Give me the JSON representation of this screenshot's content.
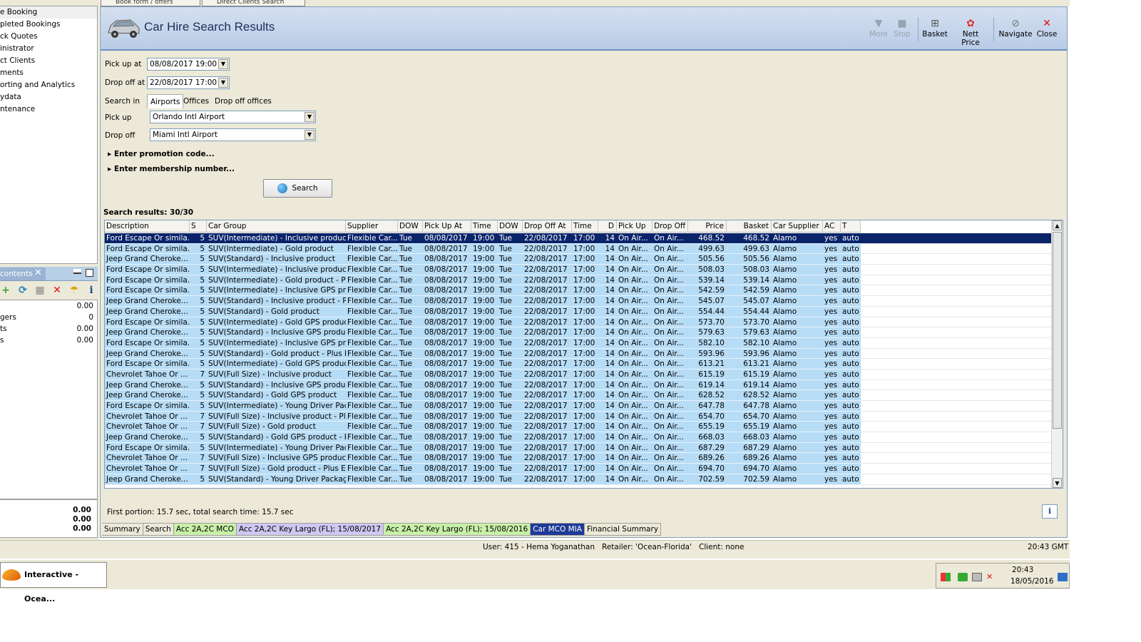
{
  "window": {
    "title": "Car Hire Search Results"
  },
  "top_tabs": [
    "Book form / offers",
    "Direct Clients Search"
  ],
  "sidebar": {
    "items": [
      {
        "label": "e Booking",
        "selected": true
      },
      {
        "label": "pleted Bookings"
      },
      {
        "label": "ck Quotes"
      },
      {
        "label": "inistrator"
      },
      {
        "label": "ct Clients"
      },
      {
        "label": "ments"
      },
      {
        "label": "orting and Analytics"
      },
      {
        "label": "ydata"
      },
      {
        "label": "ntenance"
      }
    ]
  },
  "contents": {
    "tab_label": "contents",
    "rows": [
      {
        "label": "",
        "value": "0.00"
      },
      {
        "label": "gers",
        "value": "0"
      },
      {
        "label": "ts",
        "value": "0.00"
      },
      {
        "label": "s",
        "value": "0.00"
      }
    ],
    "totals": [
      "0.00",
      "0.00",
      "0.00"
    ]
  },
  "toolbar": {
    "more": "More",
    "stop": "Stop",
    "basket": "Basket",
    "nett_price": "Nett Price",
    "navigate": "Navigate",
    "close": "Close"
  },
  "form": {
    "pickup_at_label": "Pick up at",
    "pickup_at_value": "08/08/2017 19:00",
    "dropoff_at_label": "Drop off at",
    "dropoff_at_value": "22/08/2017 17:00",
    "search_in_label": "Search in",
    "search_in_tabs": [
      "Airports",
      "Offices",
      "Drop off offices"
    ],
    "pickup_label": "Pick up",
    "pickup_value": "Orlando Intl Airport",
    "dropoff_label": "Drop off",
    "dropoff_value": "Miami Intl Airport",
    "promo_label": "Enter promotion code...",
    "membership_label": "Enter membership number...",
    "search_button": "Search"
  },
  "results": {
    "label": "Search results: 30/30",
    "columns": [
      "Description",
      "S",
      "Car Group",
      "Supplier",
      "DOW",
      "Pick Up At",
      "Time",
      "DOW",
      "Drop Off At",
      "Time",
      "D",
      "Pick Up",
      "Drop Off",
      "Price",
      "Basket",
      "Car Supplier",
      "AC",
      "T"
    ],
    "rows": [
      [
        "Ford Escape Or simila...",
        "5",
        "SUV(Intermediate) - Inclusive product",
        "Flexible Car...",
        "Tue",
        "08/08/2017",
        "19:00",
        "Tue",
        "22/08/2017",
        "17:00",
        "14",
        "On Air...",
        "On Air...",
        "468.52",
        "468.52",
        "Alamo",
        "yes",
        "auto"
      ],
      [
        "Ford Escape Or simila...",
        "5",
        "SUV(Intermediate) - Gold product",
        "Flexible Car...",
        "Tue",
        "08/08/2017",
        "19:00",
        "Tue",
        "22/08/2017",
        "17:00",
        "14",
        "On Air...",
        "On Air...",
        "499.63",
        "499.63",
        "Alamo",
        "yes",
        "auto"
      ],
      [
        "Jeep Grand Cheroke...",
        "5",
        "SUV(Standard) - Inclusive product",
        "Flexible Car...",
        "Tue",
        "08/08/2017",
        "19:00",
        "Tue",
        "22/08/2017",
        "17:00",
        "14",
        "On Air...",
        "On Air...",
        "505.56",
        "505.56",
        "Alamo",
        "yes",
        "auto"
      ],
      [
        "Ford Escape Or simila...",
        "5",
        "SUV(Intermediate) - Inclusive product...",
        "Flexible Car...",
        "Tue",
        "08/08/2017",
        "19:00",
        "Tue",
        "22/08/2017",
        "17:00",
        "14",
        "On Air...",
        "On Air...",
        "508.03",
        "508.03",
        "Alamo",
        "yes",
        "auto"
      ],
      [
        "Ford Escape Or simila...",
        "5",
        "SUV(Intermediate) - Gold product - Pl...",
        "Flexible Car...",
        "Tue",
        "08/08/2017",
        "19:00",
        "Tue",
        "22/08/2017",
        "17:00",
        "14",
        "On Air...",
        "On Air...",
        "539.14",
        "539.14",
        "Alamo",
        "yes",
        "auto"
      ],
      [
        "Ford Escape Or simila...",
        "5",
        "SUV(Intermediate) - Inclusive GPS pro...",
        "Flexible Car...",
        "Tue",
        "08/08/2017",
        "19:00",
        "Tue",
        "22/08/2017",
        "17:00",
        "14",
        "On Air...",
        "On Air...",
        "542.59",
        "542.59",
        "Alamo",
        "yes",
        "auto"
      ],
      [
        "Jeep Grand Cheroke...",
        "5",
        "SUV(Standard) - Inclusive product - Pl...",
        "Flexible Car...",
        "Tue",
        "08/08/2017",
        "19:00",
        "Tue",
        "22/08/2017",
        "17:00",
        "14",
        "On Air...",
        "On Air...",
        "545.07",
        "545.07",
        "Alamo",
        "yes",
        "auto"
      ],
      [
        "Jeep Grand Cheroke...",
        "5",
        "SUV(Standard) - Gold product",
        "Flexible Car...",
        "Tue",
        "08/08/2017",
        "19:00",
        "Tue",
        "22/08/2017",
        "17:00",
        "14",
        "On Air...",
        "On Air...",
        "554.44",
        "554.44",
        "Alamo",
        "yes",
        "auto"
      ],
      [
        "Ford Escape Or simila...",
        "5",
        "SUV(Intermediate) - Gold GPS product",
        "Flexible Car...",
        "Tue",
        "08/08/2017",
        "19:00",
        "Tue",
        "22/08/2017",
        "17:00",
        "14",
        "On Air...",
        "On Air...",
        "573.70",
        "573.70",
        "Alamo",
        "yes",
        "auto"
      ],
      [
        "Jeep Grand Cheroke...",
        "5",
        "SUV(Standard) - Inclusive GPS product",
        "Flexible Car...",
        "Tue",
        "08/08/2017",
        "19:00",
        "Tue",
        "22/08/2017",
        "17:00",
        "14",
        "On Air...",
        "On Air...",
        "579.63",
        "579.63",
        "Alamo",
        "yes",
        "auto"
      ],
      [
        "Ford Escape Or simila...",
        "5",
        "SUV(Intermediate) - Inclusive GPS pro...",
        "Flexible Car...",
        "Tue",
        "08/08/2017",
        "19:00",
        "Tue",
        "22/08/2017",
        "17:00",
        "14",
        "On Air...",
        "On Air...",
        "582.10",
        "582.10",
        "Alamo",
        "yes",
        "auto"
      ],
      [
        "Jeep Grand Cheroke...",
        "5",
        "SUV(Standard) - Gold product - Plus E...",
        "Flexible Car...",
        "Tue",
        "08/08/2017",
        "19:00",
        "Tue",
        "22/08/2017",
        "17:00",
        "14",
        "On Air...",
        "On Air...",
        "593.96",
        "593.96",
        "Alamo",
        "yes",
        "auto"
      ],
      [
        "Ford Escape Or simila...",
        "5",
        "SUV(Intermediate) - Gold GPS product...",
        "Flexible Car...",
        "Tue",
        "08/08/2017",
        "19:00",
        "Tue",
        "22/08/2017",
        "17:00",
        "14",
        "On Air...",
        "On Air...",
        "613.21",
        "613.21",
        "Alamo",
        "yes",
        "auto"
      ],
      [
        "Chevrolet Tahoe Or ...",
        "7",
        "SUV(Full Size) - Inclusive product",
        "Flexible Car...",
        "Tue",
        "08/08/2017",
        "19:00",
        "Tue",
        "22/08/2017",
        "17:00",
        "14",
        "On Air...",
        "On Air...",
        "615.19",
        "615.19",
        "Alamo",
        "yes",
        "auto"
      ],
      [
        "Jeep Grand Cheroke...",
        "5",
        "SUV(Standard) - Inclusive GPS produc...",
        "Flexible Car...",
        "Tue",
        "08/08/2017",
        "19:00",
        "Tue",
        "22/08/2017",
        "17:00",
        "14",
        "On Air...",
        "On Air...",
        "619.14",
        "619.14",
        "Alamo",
        "yes",
        "auto"
      ],
      [
        "Jeep Grand Cheroke...",
        "5",
        "SUV(Standard) - Gold GPS product",
        "Flexible Car...",
        "Tue",
        "08/08/2017",
        "19:00",
        "Tue",
        "22/08/2017",
        "17:00",
        "14",
        "On Air...",
        "On Air...",
        "628.52",
        "628.52",
        "Alamo",
        "yes",
        "auto"
      ],
      [
        "Ford Escape Or simila...",
        "5",
        "SUV(Intermediate) - Young Driver Pac...",
        "Flexible Car...",
        "Tue",
        "08/08/2017",
        "19:00",
        "Tue",
        "22/08/2017",
        "17:00",
        "14",
        "On Air...",
        "On Air...",
        "647.78",
        "647.78",
        "Alamo",
        "yes",
        "auto"
      ],
      [
        "Chevrolet Tahoe Or ...",
        "7",
        "SUV(Full Size) - Inclusive product - Plu...",
        "Flexible Car...",
        "Tue",
        "08/08/2017",
        "19:00",
        "Tue",
        "22/08/2017",
        "17:00",
        "14",
        "On Air...",
        "On Air...",
        "654.70",
        "654.70",
        "Alamo",
        "yes",
        "auto"
      ],
      [
        "Chevrolet Tahoe Or ...",
        "7",
        "SUV(Full Size) - Gold product",
        "Flexible Car...",
        "Tue",
        "08/08/2017",
        "19:00",
        "Tue",
        "22/08/2017",
        "17:00",
        "14",
        "On Air...",
        "On Air...",
        "655.19",
        "655.19",
        "Alamo",
        "yes",
        "auto"
      ],
      [
        "Jeep Grand Cheroke...",
        "5",
        "SUV(Standard) - Gold GPS product - Pl...",
        "Flexible Car...",
        "Tue",
        "08/08/2017",
        "19:00",
        "Tue",
        "22/08/2017",
        "17:00",
        "14",
        "On Air...",
        "On Air...",
        "668.03",
        "668.03",
        "Alamo",
        "yes",
        "auto"
      ],
      [
        "Ford Escape Or simila...",
        "5",
        "SUV(Intermediate) - Young Driver Pac...",
        "Flexible Car...",
        "Tue",
        "08/08/2017",
        "19:00",
        "Tue",
        "22/08/2017",
        "17:00",
        "14",
        "On Air...",
        "On Air...",
        "687.29",
        "687.29",
        "Alamo",
        "yes",
        "auto"
      ],
      [
        "Chevrolet Tahoe Or ...",
        "7",
        "SUV(Full Size) - Inclusive GPS product",
        "Flexible Car...",
        "Tue",
        "08/08/2017",
        "19:00",
        "Tue",
        "22/08/2017",
        "17:00",
        "14",
        "On Air...",
        "On Air...",
        "689.26",
        "689.26",
        "Alamo",
        "yes",
        "auto"
      ],
      [
        "Chevrolet Tahoe Or ...",
        "7",
        "SUV(Full Size) - Gold product - Plus Ex...",
        "Flexible Car...",
        "Tue",
        "08/08/2017",
        "19:00",
        "Tue",
        "22/08/2017",
        "17:00",
        "14",
        "On Air...",
        "On Air...",
        "694.70",
        "694.70",
        "Alamo",
        "yes",
        "auto"
      ],
      [
        "Jeep Grand Cheroke...",
        "5",
        "SUV(Standard) - Young Driver Packag...",
        "Flexible Car...",
        "Tue",
        "08/08/2017",
        "19:00",
        "Tue",
        "22/08/2017",
        "17:00",
        "14",
        "On Air...",
        "On Air...",
        "702.59",
        "702.59",
        "Alamo",
        "yes",
        "auto"
      ]
    ]
  },
  "timing_text": "First portion: 15.7 sec, total search time: 15.7 sec",
  "bottom_tabs": [
    {
      "label": "Summary",
      "style": "plain"
    },
    {
      "label": "Search",
      "style": "plain"
    },
    {
      "label": "Acc 2A,2C MCO",
      "style": "green"
    },
    {
      "label": "Acc 2A,2C Key Largo (FL); 15/08/2017",
      "style": "purple"
    },
    {
      "label": "Acc 2A,2C Key Largo (FL); 15/08/2016",
      "style": "green"
    },
    {
      "label": "Car MCO MIA",
      "style": "active"
    },
    {
      "label": "Financial Summary",
      "style": "plain"
    }
  ],
  "status": {
    "text": "User: 415 - Hema Yoganathan   Retailer: 'Ocean-Florida'   Client: none",
    "time": "20:43 GMT"
  },
  "taskbar": {
    "app_label": "Interactive - Ocea...",
    "clock_time": "20:43",
    "clock_date": "18/05/2016"
  },
  "colors": {
    "row_bg": "#b7dcf5",
    "selected_row": "#0a246a",
    "header_gradient_top": "#d4e0f0",
    "title_color": "#1a2f5c"
  }
}
